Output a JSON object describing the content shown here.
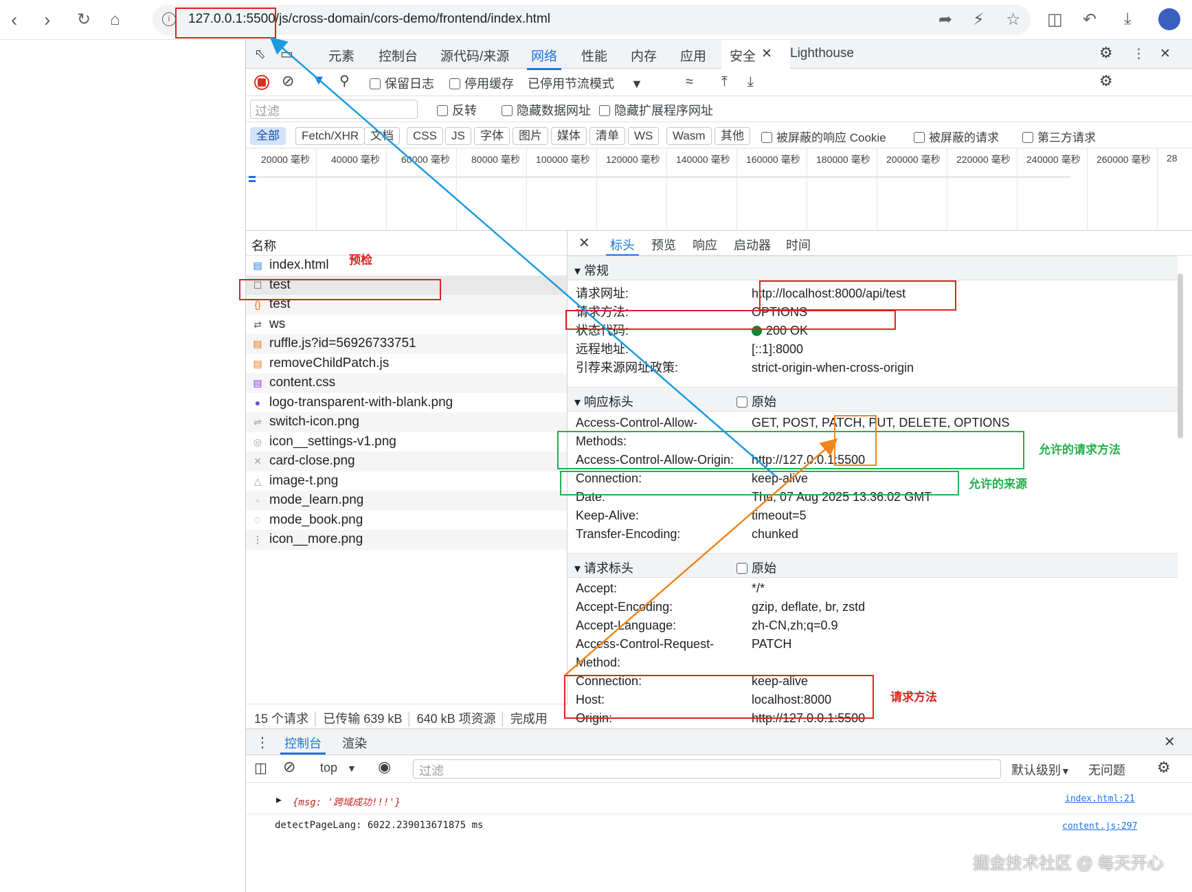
{
  "browser": {
    "url_host": "127.0.0.1:5500",
    "url_path": "/js/cross-domain/cors-demo/frontend/index.html"
  },
  "devtools": {
    "tabs": [
      "元素",
      "控制台",
      "源代码/来源",
      "网络",
      "性能",
      "内存",
      "应用",
      "安全",
      "Lighthouse"
    ],
    "active_tab": "网络",
    "toolbar": {
      "preserve_log": "保留日志",
      "disable_cache": "停用缓存",
      "throttle": "已停用节流模式"
    },
    "filter": {
      "placeholder": "过滤",
      "invert": "反转",
      "hide_data_urls": "隐藏数据网址",
      "hide_ext_urls": "隐藏扩展程序网址"
    },
    "types": [
      "全部",
      "Fetch/XHR",
      "文档",
      "CSS",
      "JS",
      "字体",
      "图片",
      "媒体",
      "清单",
      "WS",
      "Wasm",
      "其他"
    ],
    "type_checks": {
      "blocked_cookies": "被屏蔽的响应 Cookie",
      "blocked_requests": "被屏蔽的请求",
      "third_party": "第三方请求"
    },
    "timeline_ticks": [
      "20000 毫秒",
      "40000 毫秒",
      "60000 毫秒",
      "80000 毫秒",
      "100000 毫秒",
      "120000 毫秒",
      "140000 毫秒",
      "160000 毫秒",
      "180000 毫秒",
      "200000 毫秒",
      "220000 毫秒",
      "240000 毫秒",
      "260000 毫秒",
      "28"
    ],
    "list": {
      "header": "名称",
      "items": [
        {
          "name": "index.html",
          "icon": "document-icon"
        },
        {
          "name": "test",
          "icon": "checkbox-icon"
        },
        {
          "name": "test",
          "icon": "fetch-icon"
        },
        {
          "name": "ws",
          "icon": "websocket-icon"
        },
        {
          "name": "ruffle.js?id=56926733751",
          "icon": "script-icon"
        },
        {
          "name": "removeChildPatch.js",
          "icon": "script-icon"
        },
        {
          "name": "content.css",
          "icon": "stylesheet-icon"
        },
        {
          "name": "logo-transparent-with-blank.png",
          "icon": "image-icon"
        },
        {
          "name": "switch-icon.png",
          "icon": "image-icon"
        },
        {
          "name": "icon__settings-v1.png",
          "icon": "image-icon"
        },
        {
          "name": "card-close.png",
          "icon": "image-icon"
        },
        {
          "name": "image-t.png",
          "icon": "image-icon"
        },
        {
          "name": "mode_learn.png",
          "icon": "image-icon"
        },
        {
          "name": "mode_book.png",
          "icon": "image-icon"
        },
        {
          "name": "icon__more.png",
          "icon": "image-icon"
        }
      ],
      "status": {
        "requests": "15 个请求",
        "transferred": "已传输 639 kB",
        "resources": "640 kB 项资源",
        "finish": "完成用"
      }
    },
    "detail": {
      "tabs": [
        "标头",
        "预览",
        "响应",
        "启动器",
        "时间"
      ],
      "general": {
        "title": "常规",
        "rows": [
          {
            "k": "请求网址:",
            "v": "http://localhost:8000/api/test"
          },
          {
            "k": "请求方法:",
            "v": "OPTIONS"
          },
          {
            "k": "状态代码:",
            "v": "200 OK"
          },
          {
            "k": "远程地址:",
            "v": "[::1]:8000"
          },
          {
            "k": "引荐来源网址政策:",
            "v": "strict-origin-when-cross-origin"
          }
        ]
      },
      "response_headers": {
        "title": "响应标头",
        "raw": "原始",
        "rows": [
          {
            "k": "Access-Control-Allow-",
            "k2": "Methods:",
            "v": "GET, POST, PATCH, PUT, DELETE, OPTIONS"
          },
          {
            "k": "Access-Control-Allow-Origin:",
            "v": "http://127.0.0.1:5500"
          },
          {
            "k": "Connection:",
            "v": "keep-alive"
          },
          {
            "k": "Date:",
            "v": "Thu, 07 Aug 2025 13:36:02 GMT"
          },
          {
            "k": "Keep-Alive:",
            "v": "timeout=5"
          },
          {
            "k": "Transfer-Encoding:",
            "v": "chunked"
          }
        ]
      },
      "request_headers": {
        "title": "请求标头",
        "raw": "原始",
        "rows": [
          {
            "k": "Accept:",
            "v": "*/*"
          },
          {
            "k": "Accept-Encoding:",
            "v": "gzip, deflate, br, zstd"
          },
          {
            "k": "Accept-Language:",
            "v": "zh-CN,zh;q=0.9"
          },
          {
            "k": "Access-Control-Request-",
            "k2": "Method:",
            "v": "PATCH"
          },
          {
            "k": "Connection:",
            "v": "keep-alive"
          },
          {
            "k": "Host:",
            "v": "localhost:8000"
          },
          {
            "k": "Origin:",
            "v": "http://127.0.0.1:5500"
          }
        ]
      }
    },
    "drawer": {
      "tabs": [
        "控制台",
        "渲染"
      ],
      "context": "top",
      "filter_placeholder": "过滤",
      "level": "默认级别",
      "issues": "无问题",
      "logs": [
        {
          "text": "{msg: '跨域成功!!!'}",
          "source": "index.html:21"
        },
        {
          "text": "detectPageLang: 6022.239013671875 ms",
          "source": "content.js:297"
        }
      ]
    }
  },
  "annotations": {
    "preflight": "预检",
    "allowed_methods": "允许的请求方法",
    "allowed_origin": "允许的来源",
    "request_method": "请求方法"
  },
  "watermark": "掘金技术社区 @ 每天开心",
  "colors": {
    "red": "#e02020",
    "green": "#22b14c",
    "orange": "#f0861c",
    "blue": "#1a9be0",
    "accent": "#1a73e8"
  }
}
